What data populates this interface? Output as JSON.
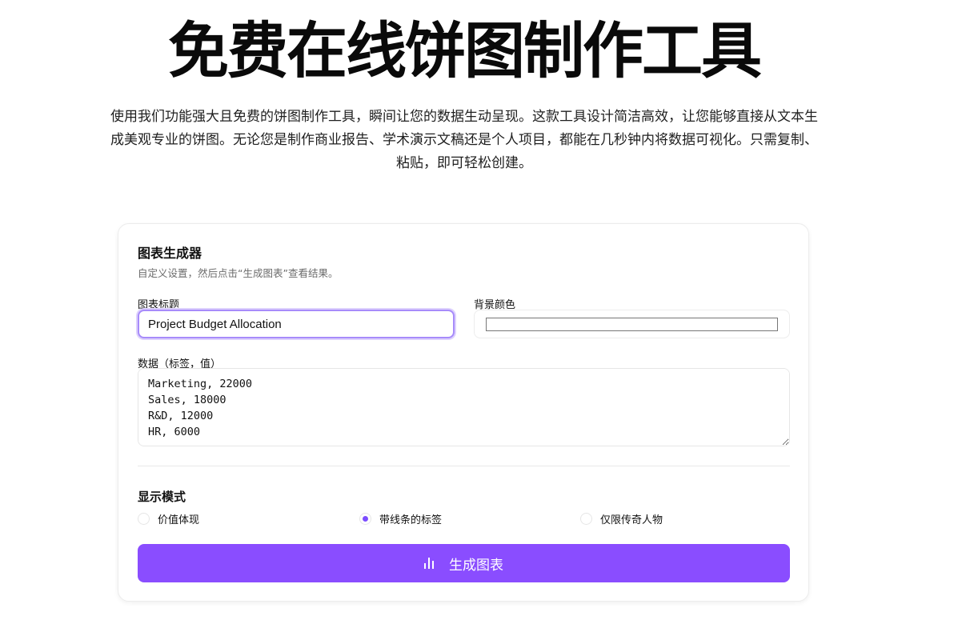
{
  "hero": {
    "title": "免费在线饼图制作工具",
    "description": "使用我们功能强大且免费的饼图制作工具，瞬间让您的数据生动呈现。这款工具设计简洁高效，让您能够直接从文本生成美观专业的饼图。无论您是制作商业报告、学术演示文稿还是个人项目，都能在几秒钟内将数据可视化。只需复制、粘贴，即可轻松创建。"
  },
  "card": {
    "title": "图表生成器",
    "subtitle": "自定义设置，然后点击“生成图表”查看结果。"
  },
  "form": {
    "chart_title_label": "图表标题",
    "chart_title_value": "Project Budget Allocation",
    "bg_color_label": "背景颜色",
    "bg_color_value": "#ffffff",
    "data_label": "数据（标签，值）",
    "data_value": "Marketing, 22000\nSales, 18000\nR&D, 12000\nHR, 6000"
  },
  "mode": {
    "title": "显示模式",
    "options": [
      {
        "label": "价值体现",
        "checked": false
      },
      {
        "label": "带线条的标签",
        "checked": true
      },
      {
        "label": "仅限传奇人物",
        "checked": false
      }
    ]
  },
  "generate_button": {
    "label": "生成图表",
    "icon": "bar-chart-icon"
  },
  "colors": {
    "accent": "#8a4dff",
    "focus_border": "#a78bfa"
  }
}
